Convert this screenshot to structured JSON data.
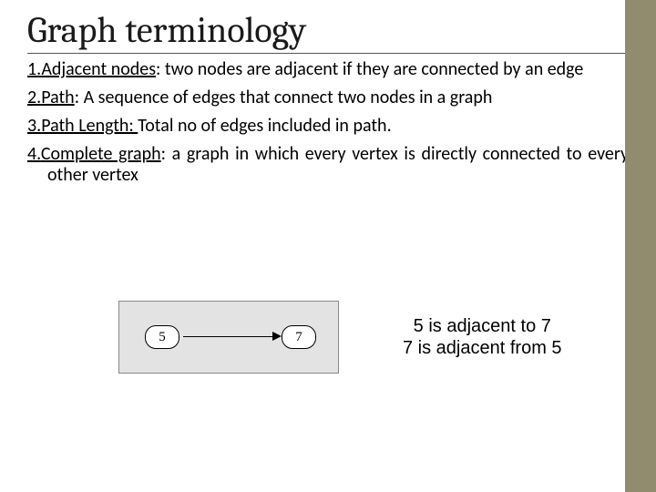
{
  "title": "Graph terminology",
  "items": [
    {
      "num": "1.",
      "term": "Adjacent nodes",
      "rest": ": two nodes are adjacent if they are connected by an edge"
    },
    {
      "num": "2.",
      "term": "Path",
      "rest": ": A sequence of edges that connect two nodes in a graph"
    },
    {
      "num": "3.",
      "term": "Path Length: ",
      "rest": "Total no of edges included in path."
    },
    {
      "num": "4.",
      "term": "Complete graph",
      "rest": ": a graph in which every vertex is directly connected to every other vertex"
    }
  ],
  "diagram": {
    "node_left": "5",
    "node_right": "7"
  },
  "caption": {
    "line1": "5 is adjacent to 7",
    "line2": "7 is adjacent from 5"
  }
}
